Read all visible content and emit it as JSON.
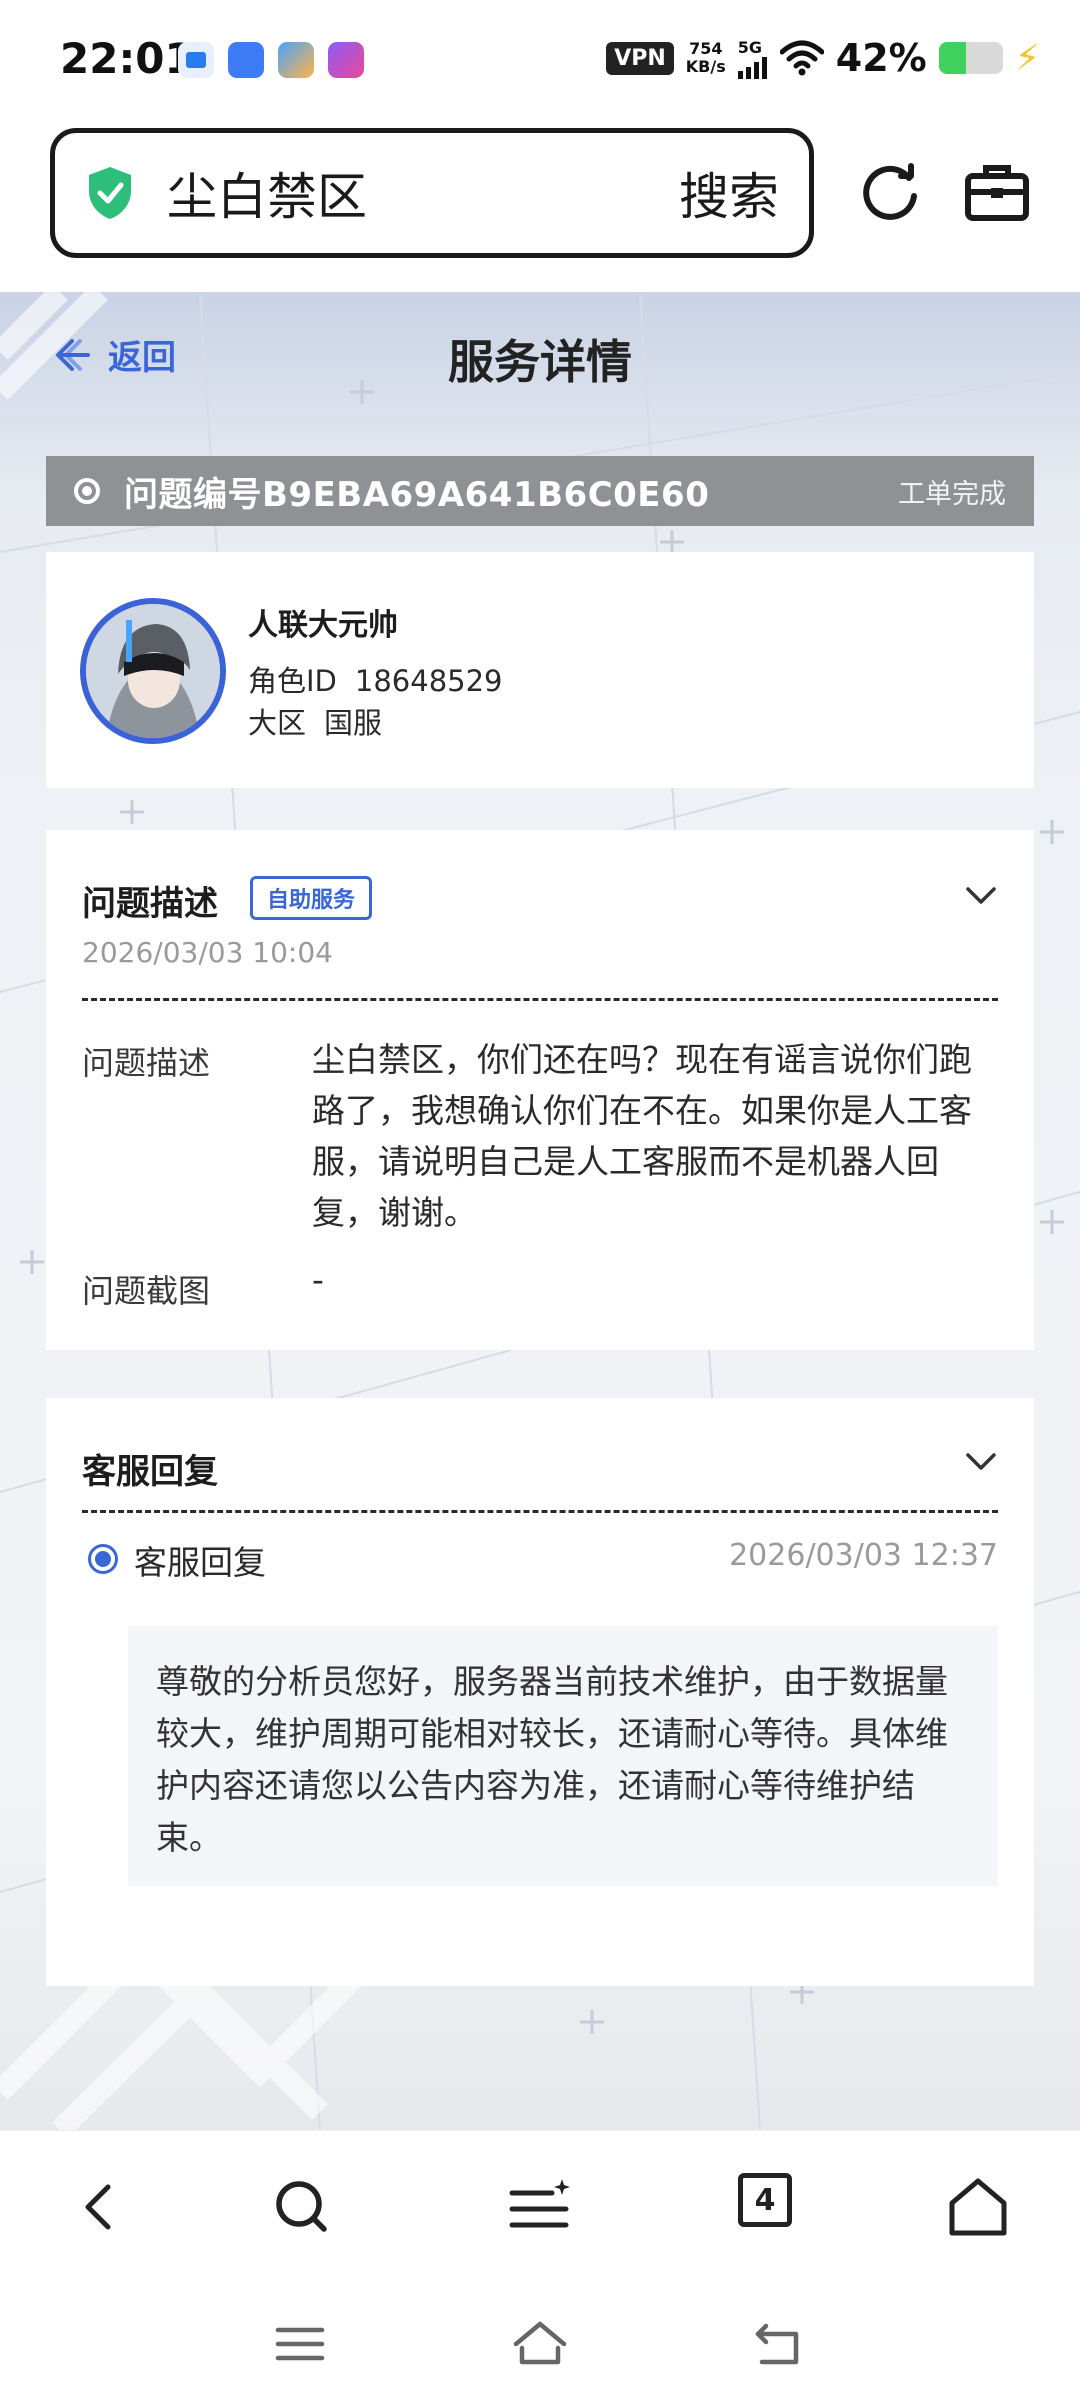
{
  "status_bar": {
    "time": "22:01",
    "vpn": "VPN",
    "net_speed_value": "754",
    "net_speed_unit": "KB/s",
    "network": "5G",
    "battery_pct": "42%",
    "battery_level": 0.42,
    "colors": {
      "battery": "#3fd15b",
      "charging": "#f4c32a"
    }
  },
  "browser": {
    "url_text": "尘白禁区",
    "search_label": "搜索",
    "icons": [
      "shield-check-icon",
      "refresh-icon",
      "briefcase-icon"
    ]
  },
  "page": {
    "back_label": "返回",
    "title": "服务详情"
  },
  "ticket": {
    "label": "问题编号B9EBA69A641B6C0E60",
    "status": "工单完成"
  },
  "user": {
    "name": "人联大元帅",
    "role_id_label": "角色ID",
    "role_id": "18648529",
    "region_label": "大区",
    "region": "国服"
  },
  "problem": {
    "title": "问题描述",
    "tag": "自助服务",
    "date": "2026/03/03 10:04",
    "desc_label": "问题描述",
    "desc_value": "尘白禁区，你们还在吗？现在有谣言说你们跑路了，我想确认你们在不在。如果你是人工客服，请说明自己是人工客服而不是机器人回复，谢谢。",
    "screenshot_label": "问题截图",
    "screenshot_value": "-"
  },
  "reply": {
    "title": "客服回复",
    "label": "客服回复",
    "time": "2026/03/03 12:37",
    "content": "尊敬的分析员您好，服务器当前技术维护，由于数据量较大，维护周期可能相对较长，还请耐心等待。具体维护内容还请您以公告内容为准，还请耐心等待维护结束。"
  },
  "bottom_toolbar": {
    "tab_count": "4",
    "icons": [
      "back-icon",
      "search-icon",
      "menu-icon",
      "tabs-icon",
      "home-icon"
    ]
  },
  "nav_bar": {
    "icons": [
      "recent-apps-icon",
      "home-nav-icon",
      "back-nav-icon"
    ]
  },
  "colors": {
    "accent": "#3a66d6",
    "ticket_bar": "#8f9195",
    "shield": "#2dbf7a"
  }
}
